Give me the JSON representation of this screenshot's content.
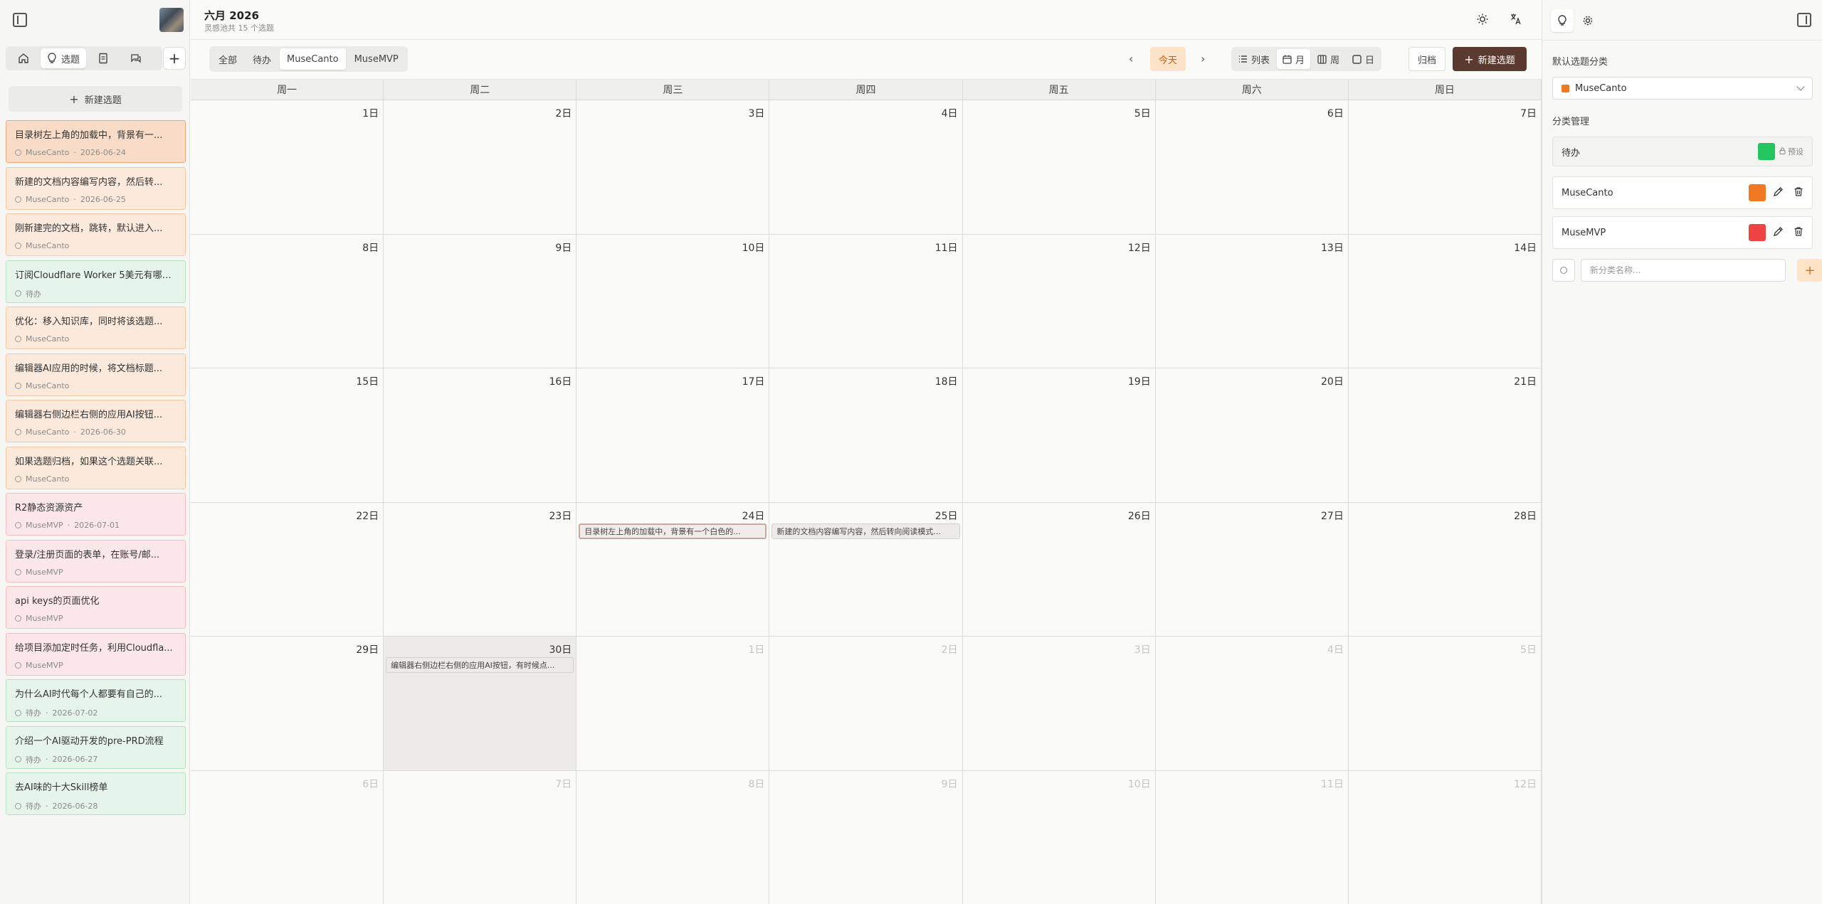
{
  "left_nav": {
    "tabs": [
      {
        "name": "home",
        "label": ""
      },
      {
        "name": "topics",
        "label": "选题"
      },
      {
        "name": "docs",
        "label": ""
      },
      {
        "name": "chat",
        "label": ""
      }
    ],
    "new_topic_label": "新建选题",
    "topics": [
      {
        "title": "目录树左上角的加载中，背景有一...",
        "category": "MuseCanto",
        "date": "2026-06-24",
        "color": "orange",
        "selected": true
      },
      {
        "title": "新建的文档内容编写内容，然后转...",
        "category": "MuseCanto",
        "date": "2026-06-25",
        "color": "orange"
      },
      {
        "title": "刚新建完的文档，跳转，默认进入...",
        "category": "MuseCanto",
        "date": "",
        "color": "orange"
      },
      {
        "title": "订阅Cloudflare Worker 5美元有哪些...",
        "category": "待办",
        "date": "",
        "color": "green"
      },
      {
        "title": "优化：移入知识库，同时将该选题...",
        "category": "MuseCanto",
        "date": "",
        "color": "orange"
      },
      {
        "title": "编辑器AI应用的时候，将文档标题...",
        "category": "MuseCanto",
        "date": "",
        "color": "orange"
      },
      {
        "title": "编辑器右侧边栏右侧的应用AI按钮...",
        "category": "MuseCanto",
        "date": "2026-06-30",
        "color": "orange"
      },
      {
        "title": "如果选题归档，如果这个选题关联...",
        "category": "MuseCanto",
        "date": "",
        "color": "orange"
      },
      {
        "title": "R2静态资源资产",
        "category": "MuseMVP",
        "date": "2026-07-01",
        "color": "red"
      },
      {
        "title": "登录/注册页面的表单，在账号/邮...",
        "category": "MuseMVP",
        "date": "",
        "color": "red"
      },
      {
        "title": "api keys的页面优化",
        "category": "MuseMVP",
        "date": "",
        "color": "red"
      },
      {
        "title": "给项目添加定时任务，利用Cloudfla...",
        "category": "MuseMVP",
        "date": "",
        "color": "red"
      },
      {
        "title": "为什么AI时代每个人都要有自己的...",
        "category": "待办",
        "date": "2026-07-02",
        "color": "green"
      },
      {
        "title": "介绍一个AI驱动开发的pre-PRD流程",
        "category": "待办",
        "date": "2026-06-27",
        "color": "green"
      },
      {
        "title": "去AI味的十大Skill榜单",
        "category": "待办",
        "date": "2026-06-28",
        "color": "green"
      }
    ]
  },
  "header": {
    "month_title": "六月 2026",
    "count_text": "灵感池共 15 个选题"
  },
  "toolbar": {
    "filters": [
      {
        "label": "全部",
        "active": false
      },
      {
        "label": "待办",
        "active": false
      },
      {
        "label": "MuseCanto",
        "active": true
      },
      {
        "label": "MuseMVP",
        "active": false
      }
    ],
    "today_label": "今天",
    "views": [
      {
        "label": "列表",
        "icon": "list-icon",
        "active": false
      },
      {
        "label": "月",
        "icon": "calendar-icon",
        "active": true
      },
      {
        "label": "周",
        "icon": "columns-icon",
        "active": false
      },
      {
        "label": "日",
        "icon": "square-icon",
        "active": false
      }
    ],
    "archive_label": "归档",
    "new_topic_label": "新建选题"
  },
  "calendar": {
    "weekdays": [
      "周一",
      "周二",
      "周三",
      "周四",
      "周五",
      "周六",
      "周日"
    ],
    "weeks": [
      [
        {
          "d": "1日"
        },
        {
          "d": "2日"
        },
        {
          "d": "3日"
        },
        {
          "d": "4日"
        },
        {
          "d": "5日"
        },
        {
          "d": "6日"
        },
        {
          "d": "7日"
        }
      ],
      [
        {
          "d": "8日"
        },
        {
          "d": "9日"
        },
        {
          "d": "10日"
        },
        {
          "d": "11日"
        },
        {
          "d": "12日"
        },
        {
          "d": "13日"
        },
        {
          "d": "14日"
        }
      ],
      [
        {
          "d": "15日"
        },
        {
          "d": "16日"
        },
        {
          "d": "17日"
        },
        {
          "d": "18日"
        },
        {
          "d": "19日"
        },
        {
          "d": "20日"
        },
        {
          "d": "21日"
        }
      ],
      [
        {
          "d": "22日"
        },
        {
          "d": "23日"
        },
        {
          "d": "24日",
          "event": "目录树左上角的加载中，背景有一个白色的...",
          "event_selected": true
        },
        {
          "d": "25日",
          "event": "新建的文档内容编写内容，然后转向阅读模式..."
        },
        {
          "d": "26日"
        },
        {
          "d": "27日"
        },
        {
          "d": "28日"
        }
      ],
      [
        {
          "d": "29日"
        },
        {
          "d": "30日",
          "today": true,
          "event": "编辑器右侧边栏右侧的应用AI按钮，有时候点..."
        },
        {
          "d": "1日",
          "out": true
        },
        {
          "d": "2日",
          "out": true
        },
        {
          "d": "3日",
          "out": true
        },
        {
          "d": "4日",
          "out": true
        },
        {
          "d": "5日",
          "out": true
        }
      ],
      [
        {
          "d": "6日",
          "out": true
        },
        {
          "d": "7日",
          "out": true
        },
        {
          "d": "8日",
          "out": true
        },
        {
          "d": "9日",
          "out": true
        },
        {
          "d": "10日",
          "out": true
        },
        {
          "d": "11日",
          "out": true
        },
        {
          "d": "12日",
          "out": true
        }
      ]
    ]
  },
  "right_panel": {
    "default_category_label": "默认选题分类",
    "default_category_value": "MuseCanto",
    "default_category_color": "#f07a24",
    "manage_label": "分类管理",
    "categories": [
      {
        "name": "待办",
        "color": "#22c55e",
        "locked": true,
        "lock_label": "预设"
      },
      {
        "name": "MuseCanto",
        "color": "#f07a24",
        "locked": false
      },
      {
        "name": "MuseMVP",
        "color": "#ef4444",
        "locked": false
      }
    ],
    "new_category_placeholder": "新分类名称..."
  }
}
